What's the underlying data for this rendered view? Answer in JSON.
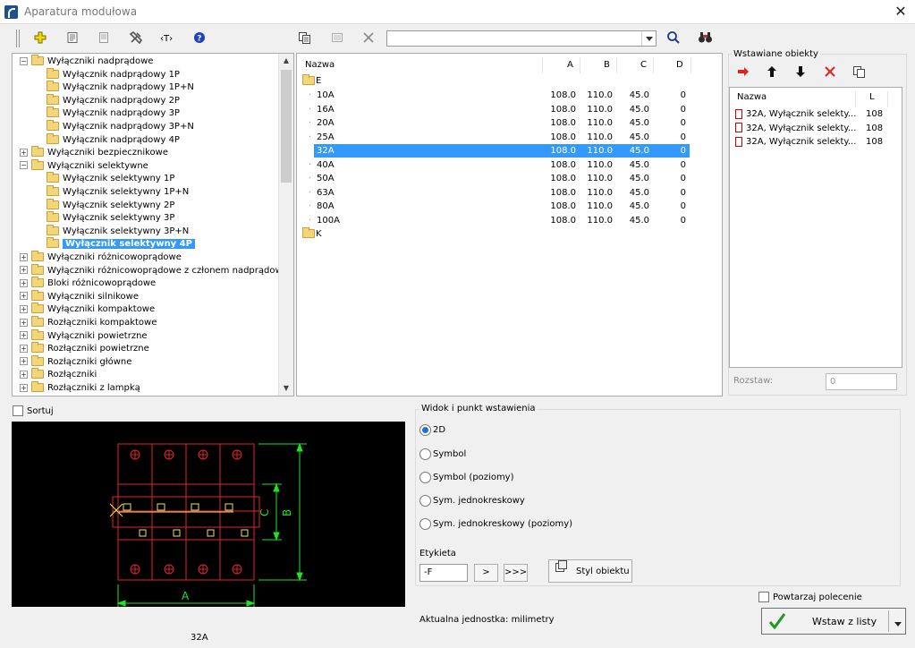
{
  "window": {
    "title": "Aparatura modułowa",
    "close": "✕"
  },
  "toolbar": {
    "left_icons": [
      "add-icon",
      "properties-icon",
      "document-icon",
      "tools-icon",
      "text-tag-icon",
      "help-icon"
    ],
    "middle_icons": [
      "copy-icon",
      "copy-disabled-icon",
      "delete-icon"
    ],
    "combo_value": "",
    "right_icons": [
      "search-icon",
      "binoculars-icon"
    ]
  },
  "tree": {
    "items": [
      {
        "label": "Wyłączniki nadprądowe",
        "level": 0,
        "expander": "⊟"
      },
      {
        "label": "Wyłącznik nadprądowy 1P",
        "level": 1
      },
      {
        "label": "Wyłącznik nadprądowy 1P+N",
        "level": 1
      },
      {
        "label": "Wyłącznik nadprądowy 2P",
        "level": 1
      },
      {
        "label": "Wyłącznik nadprądowy 3P",
        "level": 1
      },
      {
        "label": "Wyłącznik nadprądowy 3P+N",
        "level": 1
      },
      {
        "label": "Wyłącznik nadprądowy 4P",
        "level": 1
      },
      {
        "label": "Wyłączniki bezpiecznikowe",
        "level": 0,
        "expander": "⊞"
      },
      {
        "label": "Wyłączniki selektywne",
        "level": 0,
        "expander": "⊟"
      },
      {
        "label": "Wyłącznik selektywny 1P",
        "level": 1
      },
      {
        "label": "Wyłącznik selektywny 1P+N",
        "level": 1
      },
      {
        "label": "Wyłącznik selektywny 2P",
        "level": 1
      },
      {
        "label": "Wyłącznik selektywny 3P",
        "level": 1
      },
      {
        "label": "Wyłącznik selektywny 3P+N",
        "level": 1
      },
      {
        "label": "Wyłącznik selektywny 4P",
        "level": 1,
        "selected": true
      },
      {
        "label": "Wyłączniki różnicowoprądowe",
        "level": 0,
        "expander": "⊞"
      },
      {
        "label": "Wyłączniki różnicowoprądowe z członem nadprądowym",
        "level": 0,
        "expander": "⊞"
      },
      {
        "label": "Bloki różnicowoprądowe",
        "level": 0,
        "expander": "⊞"
      },
      {
        "label": "Wyłączniki silnikowe",
        "level": 0,
        "expander": "⊞"
      },
      {
        "label": "Wyłączniki kompaktowe",
        "level": 0,
        "expander": "⊞"
      },
      {
        "label": "Rozłączniki kompaktowe",
        "level": 0,
        "expander": "⊞"
      },
      {
        "label": "Wyłączniki powietrzne",
        "level": 0,
        "expander": "⊞"
      },
      {
        "label": "Rozłączniki powietrzne",
        "level": 0,
        "expander": "⊞"
      },
      {
        "label": "Rozłączniki główne",
        "level": 0,
        "expander": "⊞"
      },
      {
        "label": "Rozłączniki",
        "level": 0,
        "expander": "⊞"
      },
      {
        "label": "Rozłączniki z lampką",
        "level": 0,
        "expander": "⊞"
      }
    ]
  },
  "list": {
    "headers": [
      "Nazwa",
      "A",
      "B",
      "C",
      "D"
    ],
    "group_e": "E",
    "group_k": "K",
    "rows": [
      {
        "name": "10A",
        "a": "108.0",
        "b": "110.0",
        "c": "45.0",
        "d": "0"
      },
      {
        "name": "16A",
        "a": "108.0",
        "b": "110.0",
        "c": "45.0",
        "d": "0"
      },
      {
        "name": "20A",
        "a": "108.0",
        "b": "110.0",
        "c": "45.0",
        "d": "0"
      },
      {
        "name": "25A",
        "a": "108.0",
        "b": "110.0",
        "c": "45.0",
        "d": "0"
      },
      {
        "name": "32A",
        "a": "108.0",
        "b": "110.0",
        "c": "45.0",
        "d": "0",
        "selected": true
      },
      {
        "name": "40A",
        "a": "108.0",
        "b": "110.0",
        "c": "45.0",
        "d": "0"
      },
      {
        "name": "50A",
        "a": "108.0",
        "b": "110.0",
        "c": "45.0",
        "d": "0"
      },
      {
        "name": "63A",
        "a": "108.0",
        "b": "110.0",
        "c": "45.0",
        "d": "0"
      },
      {
        "name": "80A",
        "a": "108.0",
        "b": "110.0",
        "c": "45.0",
        "d": "0"
      },
      {
        "name": "100A",
        "a": "108.0",
        "b": "110.0",
        "c": "45.0",
        "d": "0"
      }
    ]
  },
  "inserted": {
    "title": "Wstawiane obiekty",
    "icons": [
      "arrow-right-icon",
      "arrow-up-icon",
      "arrow-down-icon",
      "remove-icon",
      "copy-icon"
    ],
    "headers": [
      "Nazwa",
      "L"
    ],
    "rows": [
      {
        "name": "32A, Wyłącznik selekty...",
        "l": "108"
      },
      {
        "name": "32A, Wyłącznik selekty...",
        "l": "108"
      },
      {
        "name": "32A, Wyłącznik selekty...",
        "l": "108"
      }
    ],
    "rozstaw_label": "Rozstaw:",
    "rozstaw_value": "0"
  },
  "sort_label": "Sortuj",
  "preview": {
    "caption": "32A",
    "dim_a": "A",
    "dim_b": "B",
    "dim_c": "C"
  },
  "view": {
    "legend": "Widok i punkt wstawienia",
    "options": [
      "2D",
      "Symbol",
      "Symbol (poziomy)",
      "Sym. jednokreskowy",
      "Sym. jednokreskowy (poziomy)"
    ],
    "selected": "2D"
  },
  "label_section": {
    "title": "Etykieta",
    "value": "-F",
    "next": ">",
    "all": ">>>",
    "style_button": "Styl obiektu"
  },
  "unit": "Aktualna jednostka: milimetry",
  "repeat_label": "Powtarzaj polecenie",
  "insert_button": "Wstaw z listy",
  "colors": {
    "selection": "#3399ff",
    "drawing_red": "#e0262b",
    "drawing_green": "#22e022",
    "drawing_yellow": "#f0e060"
  }
}
